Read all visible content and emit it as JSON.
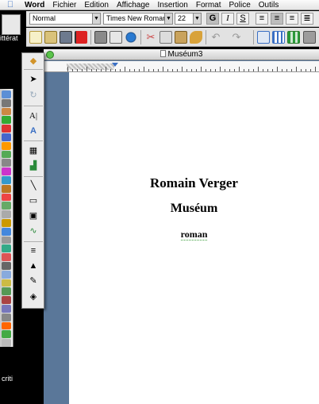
{
  "menubar": {
    "apple": "",
    "items": [
      "Word",
      "Fichier",
      "Edition",
      "Affichage",
      "Insertion",
      "Format",
      "Police",
      "Outils"
    ]
  },
  "desktop": {
    "icon_label": "ittérat",
    "bottom_label": "criti"
  },
  "format_toolbar": {
    "style_value": "Normal",
    "font_value": "Times New Roman",
    "size_value": "22",
    "bold": "G",
    "italic": "I",
    "underline": "S"
  },
  "window": {
    "title": "Muséum3"
  },
  "document": {
    "author": "Romain Verger",
    "title": "Muséum",
    "subtitle": "roman"
  },
  "colors": {
    "window_bg": "#5a7799",
    "accent": "#3a6fc4"
  }
}
